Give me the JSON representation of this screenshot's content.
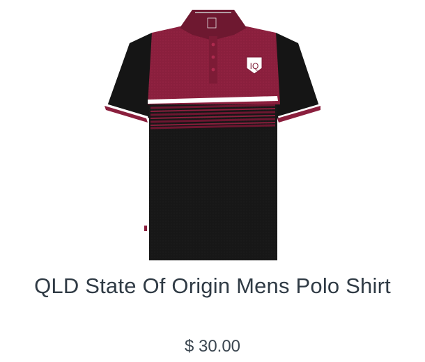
{
  "product": {
    "title": "QLD State Of Origin Mens Polo Shirt",
    "price": "$ 30.00",
    "image_icon": "polo-shirt-image",
    "colors": {
      "maroon": "#8a1f3d",
      "black": "#161616",
      "white": "#ffffff",
      "text": "#2f3a44"
    }
  }
}
